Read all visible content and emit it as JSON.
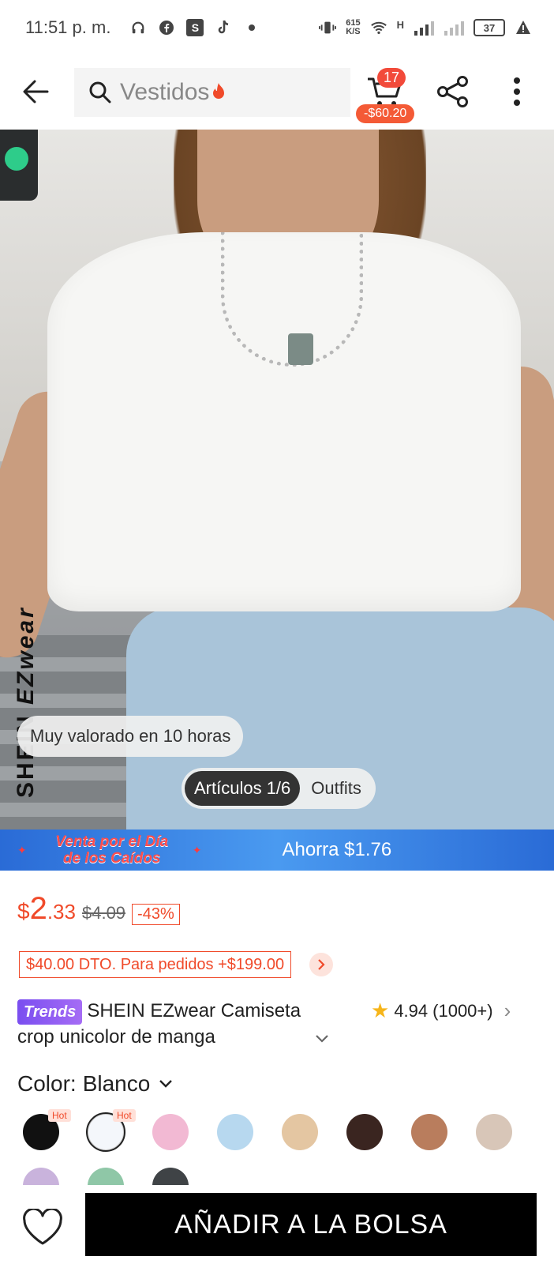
{
  "status_bar": {
    "time": "11:51 p. m.",
    "net_speed_value": "615",
    "net_speed_unit": "K/S",
    "network_label": "H",
    "battery": "37"
  },
  "header": {
    "search_placeholder": "Vestidos",
    "cart_count": "17",
    "cart_total": "-$60.20"
  },
  "hero": {
    "brand_vertical": "SHEIN",
    "brand_suffix": "EZwear",
    "rated_pill": "Muy valorado en 10 horas",
    "tabs": [
      {
        "label": "Artículos 1/6",
        "active": true
      },
      {
        "label": "Outfits",
        "active": false
      }
    ]
  },
  "promo": {
    "event_line1": "Venta por el Día",
    "event_line2": "de los Caídos",
    "save_text": "Ahorra $1.76",
    "colors": {
      "bg_from": "#2a6bd6",
      "bg_to": "#4a9af0",
      "event_text": "#ff4d4d"
    }
  },
  "product": {
    "price_currency": "$",
    "price_integer": "2",
    "price_decimal": ".33",
    "price_original": "$4.09",
    "discount": "-43%",
    "coupon": "$40.00 DTO. Para pedidos +$199.00",
    "trend_badge": "Trends",
    "title": "SHEIN EZwear Camiseta crop unicolor de manga",
    "rating": "4.94",
    "rating_count": "(1000+)",
    "color_label": "Color:",
    "color_value": "Blanco",
    "hot_label": "Hot",
    "swatches": [
      {
        "name": "black",
        "color": "#111111",
        "hot": true,
        "selected": false
      },
      {
        "name": "white",
        "color": "#f4f7fb",
        "hot": true,
        "selected": true
      },
      {
        "name": "pink",
        "color": "#f2b9d3",
        "hot": false,
        "selected": false
      },
      {
        "name": "light-blue",
        "color": "#b7d8ef",
        "hot": false,
        "selected": false
      },
      {
        "name": "beige",
        "color": "#e4c6a2",
        "hot": false,
        "selected": false
      },
      {
        "name": "dark-brown",
        "color": "#3a2520",
        "hot": false,
        "selected": false
      },
      {
        "name": "brown",
        "color": "#b97d5d",
        "hot": false,
        "selected": false
      },
      {
        "name": "taupe",
        "color": "#d8c6b8",
        "hot": false,
        "selected": false
      },
      {
        "name": "lavender",
        "color": "#c9b3dc",
        "hot": false,
        "selected": false
      },
      {
        "name": "mint",
        "color": "#8fc7a7",
        "hot": false,
        "selected": false
      },
      {
        "name": "charcoal",
        "color": "#3f4346",
        "hot": false,
        "selected": false
      }
    ],
    "accent_color": "#f04a2a"
  },
  "bottom_bar": {
    "add_to_bag": "AÑADIR A LA BOLSA"
  }
}
